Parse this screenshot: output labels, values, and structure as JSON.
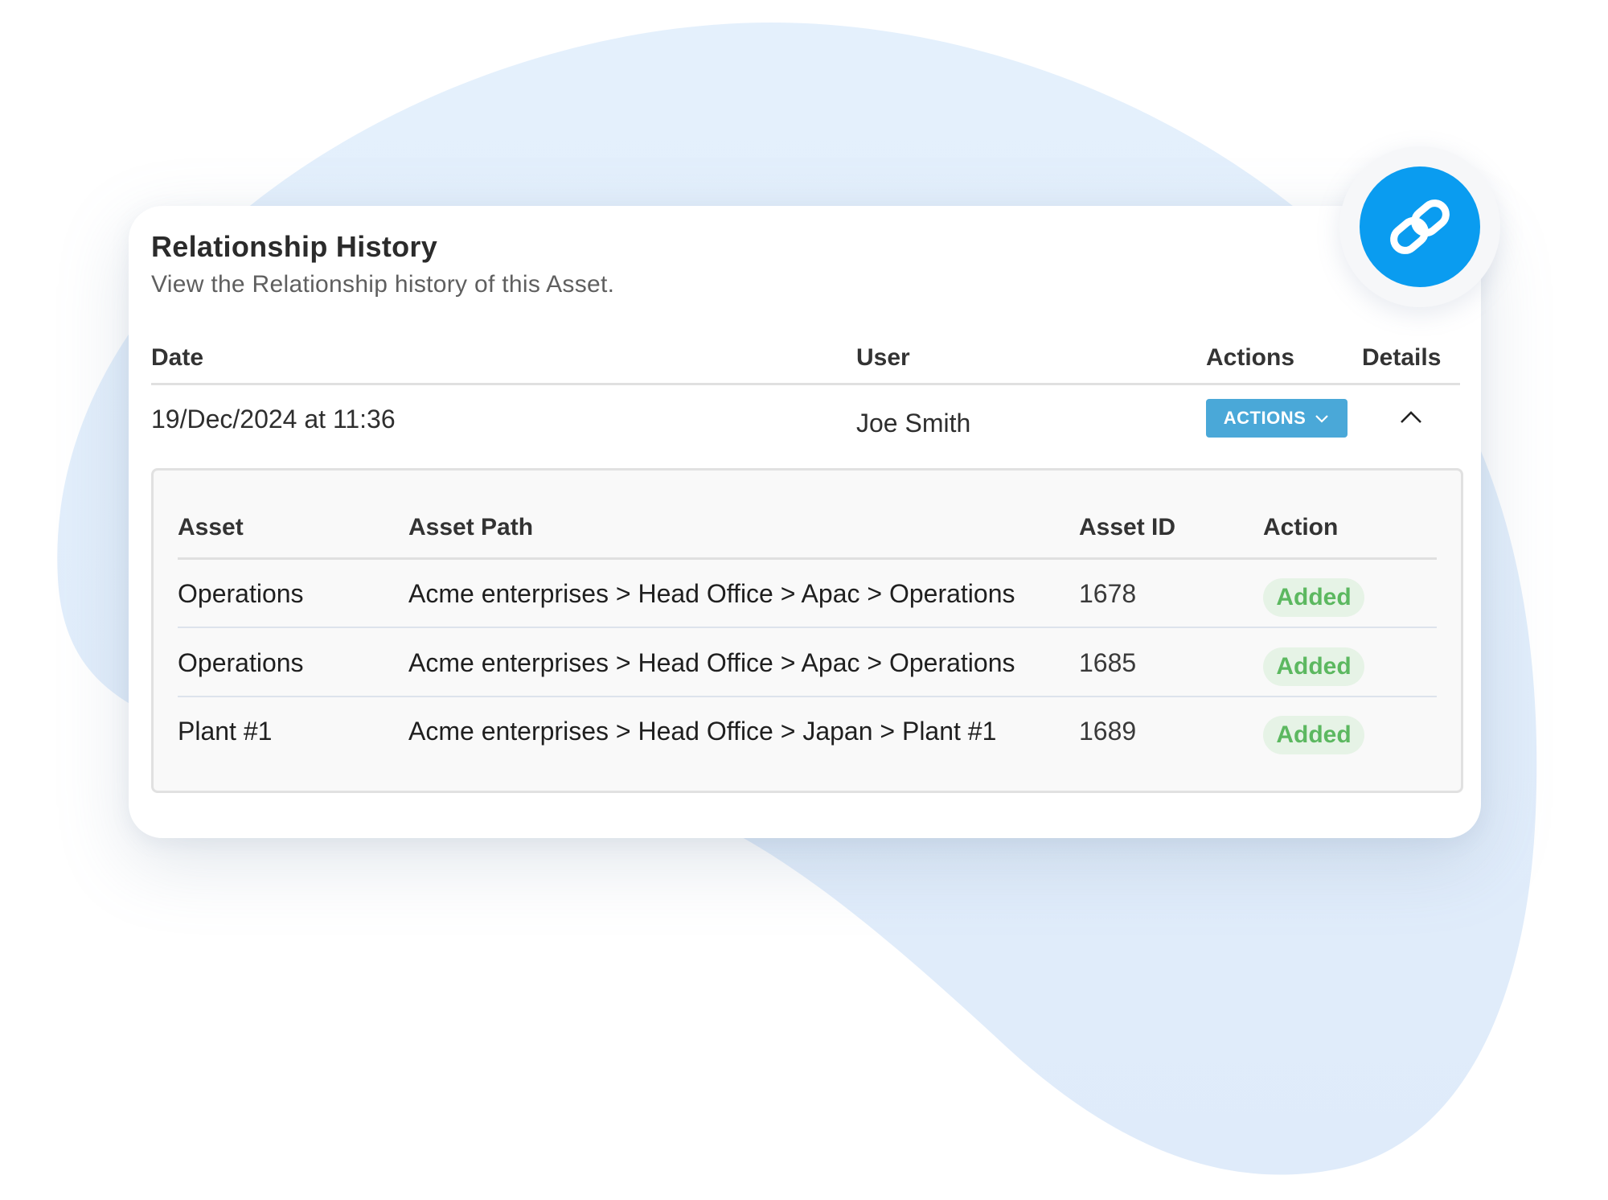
{
  "card": {
    "title": "Relationship History",
    "subtitle": "View the Relationship history of this Asset."
  },
  "table": {
    "columns": {
      "date": "Date",
      "user": "User",
      "actions": "Actions",
      "details": "Details"
    },
    "row": {
      "date": "19/Dec/2024 at 11:36",
      "user": "Joe Smith",
      "actions_button": "ACTIONS"
    }
  },
  "details": {
    "columns": {
      "asset": "Asset",
      "asset_path": "Asset Path",
      "asset_id": "Asset ID",
      "action": "Action"
    },
    "rows": [
      {
        "asset": "Operations",
        "asset_path": "Acme enterprises > Head Office > Apac > Operations",
        "asset_id": "1678",
        "action": "Added"
      },
      {
        "asset": "Operations",
        "asset_path": "Acme enterprises > Head Office > Apac > Operations",
        "asset_id": "1685",
        "action": "Added"
      },
      {
        "asset": "Plant #1",
        "asset_path": "Acme enterprises > Head Office > Japan > Plant #1",
        "asset_id": "1689",
        "action": "Added"
      }
    ]
  },
  "icons": {
    "badge": "link-icon",
    "collapse": "chevron-up-icon",
    "dropdown": "chevron-down-icon"
  },
  "colors": {
    "accent_blue": "#0a9cf0",
    "button_blue": "#4aa8d8",
    "added_green": "#5cb860",
    "added_bg": "#e6f3e6",
    "blob": "#e3effc"
  }
}
